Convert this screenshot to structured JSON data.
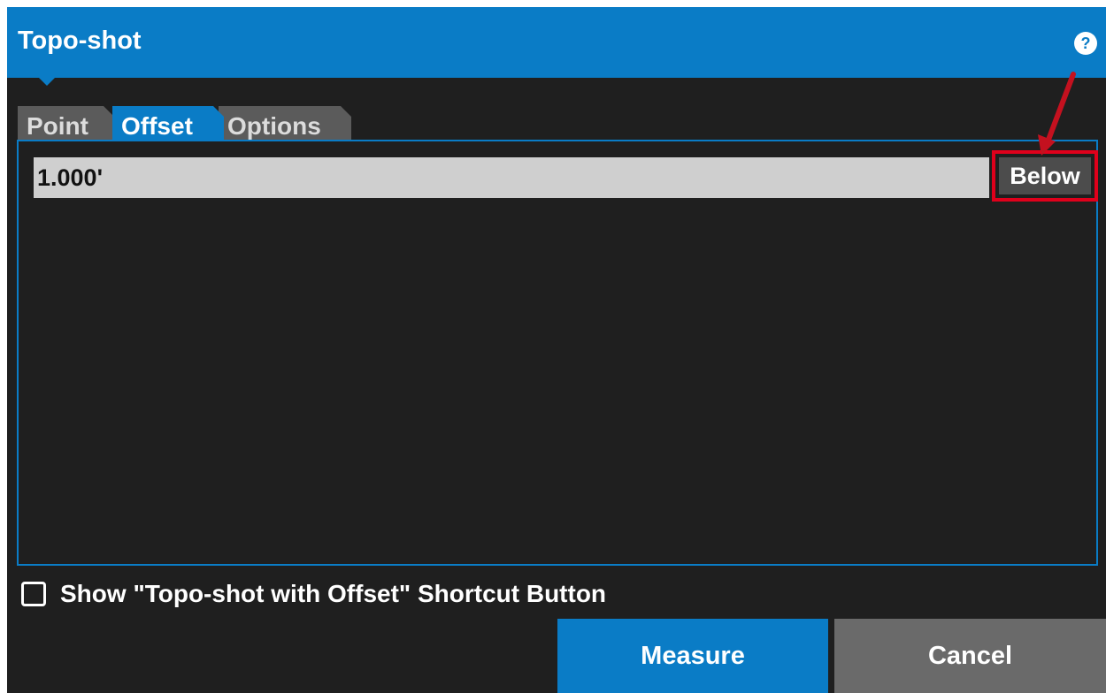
{
  "dialog": {
    "title": "Topo-shot",
    "help_label": "?"
  },
  "tabs": [
    {
      "label": "Point",
      "active": false
    },
    {
      "label": "Offset",
      "active": true
    },
    {
      "label": "Options",
      "active": false
    }
  ],
  "offset": {
    "value": "1.000'",
    "direction_label": "Below"
  },
  "shortcut": {
    "label": "Show \"Topo-shot with Offset\" Shortcut Button",
    "checked": false
  },
  "actions": {
    "measure_label": "Measure",
    "cancel_label": "Cancel"
  },
  "colors": {
    "accent": "#0a7cc6",
    "highlight": "#e0001b",
    "background": "#1f1f1f"
  }
}
